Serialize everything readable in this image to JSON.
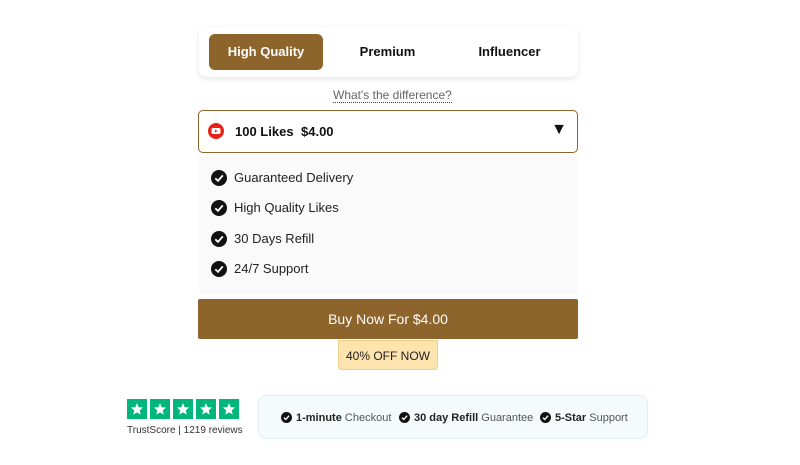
{
  "tabs": [
    {
      "label": "High Quality",
      "active": true
    },
    {
      "label": "Premium",
      "active": false
    },
    {
      "label": "Influencer",
      "active": false
    }
  ],
  "diff_link": "What's the difference?",
  "package": {
    "icon": "youtube-icon",
    "label": "100 Likes",
    "price": "$4.00",
    "caret": "▼"
  },
  "features": [
    "Guaranteed Delivery",
    "High Quality Likes",
    "30 Days Refill",
    "24/7 Support"
  ],
  "buy_button": "Buy Now For $4.00",
  "discount_badge": "40% OFF NOW",
  "trustpilot": {
    "text": "TrustScore | 1219 reviews",
    "star_count": 5
  },
  "perks": [
    {
      "bold": "1-minute",
      "rest": "Checkout"
    },
    {
      "bold": "30 day Refill",
      "rest": "Guarantee"
    },
    {
      "bold": "5-Star",
      "rest": "Support"
    }
  ],
  "colors": {
    "brand": "#8d642b",
    "badge": "#fde3ae",
    "trustpilot": "#00b67a",
    "youtube": "#e62117"
  }
}
